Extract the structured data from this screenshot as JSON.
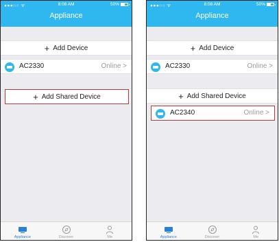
{
  "left": {
    "status": {
      "carrier": "●●●○○ ᯤ",
      "time": "8:08 AM",
      "battery": "50%"
    },
    "title": "Appliance",
    "add_device": {
      "plus": "+",
      "label": "Add Device"
    },
    "device": {
      "name": "AC2330",
      "status": "Online",
      "chevron": ">"
    },
    "add_shared": {
      "plus": "+",
      "label": "Add Shared Device"
    },
    "tabs": [
      {
        "label": "Appliance"
      },
      {
        "label": "Discover"
      },
      {
        "label": "Me"
      }
    ]
  },
  "right": {
    "status": {
      "carrier": "●●●○○ ᯤ",
      "time": "8:08 AM",
      "battery": "50%"
    },
    "title": "Appliance",
    "add_device": {
      "plus": "+",
      "label": "Add Device"
    },
    "devices": [
      {
        "name": "AC2330",
        "status": "Online",
        "chevron": ">"
      },
      {
        "name": "AC2340",
        "status": "Online",
        "chevron": ">"
      }
    ],
    "add_shared": {
      "plus": "+",
      "label": "Add Shared Device"
    },
    "tabs": [
      {
        "label": "Appliance"
      },
      {
        "label": "Discover"
      },
      {
        "label": "Me"
      }
    ]
  },
  "colors": {
    "header": "#2fb8f0",
    "active_tab": "#2a7fd8",
    "highlight_border": "#b83a3a"
  }
}
